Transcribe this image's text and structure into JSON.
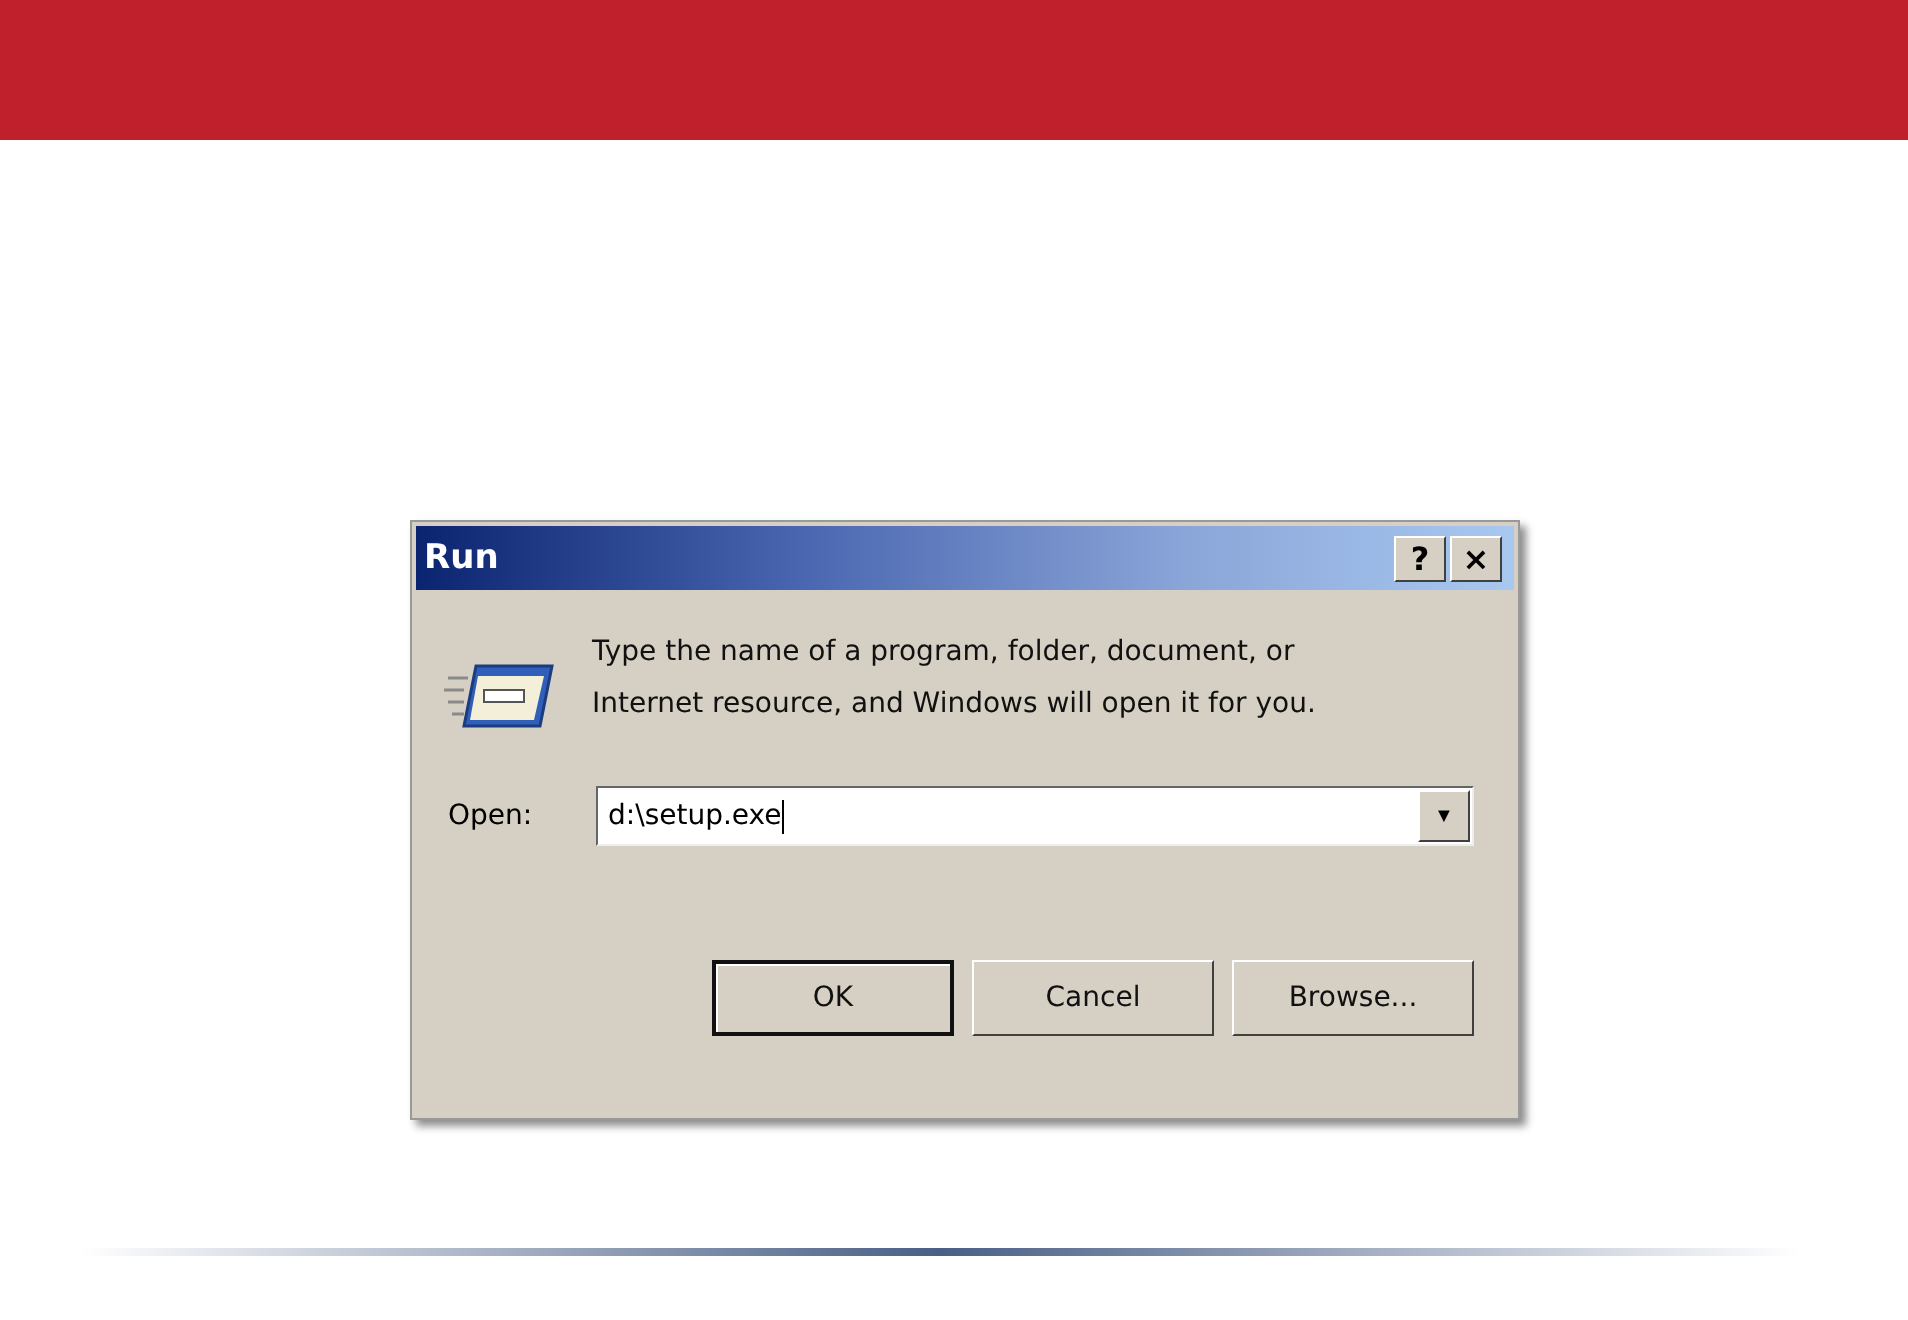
{
  "window": {
    "title": "Run",
    "title_buttons": [
      "?",
      "×"
    ]
  },
  "message": [
    "Type the name of a program, folder, document, or",
    "Internet resource, and Windows will open it for you."
  ],
  "open_field": {
    "label": "Open:",
    "value": "d:\\setup.exe",
    "dropdown": "▼"
  },
  "buttons": [
    {
      "label": "OK",
      "default": true
    },
    {
      "label": "Cancel",
      "default": false
    },
    {
      "label": "Browse...",
      "default": false
    }
  ]
}
